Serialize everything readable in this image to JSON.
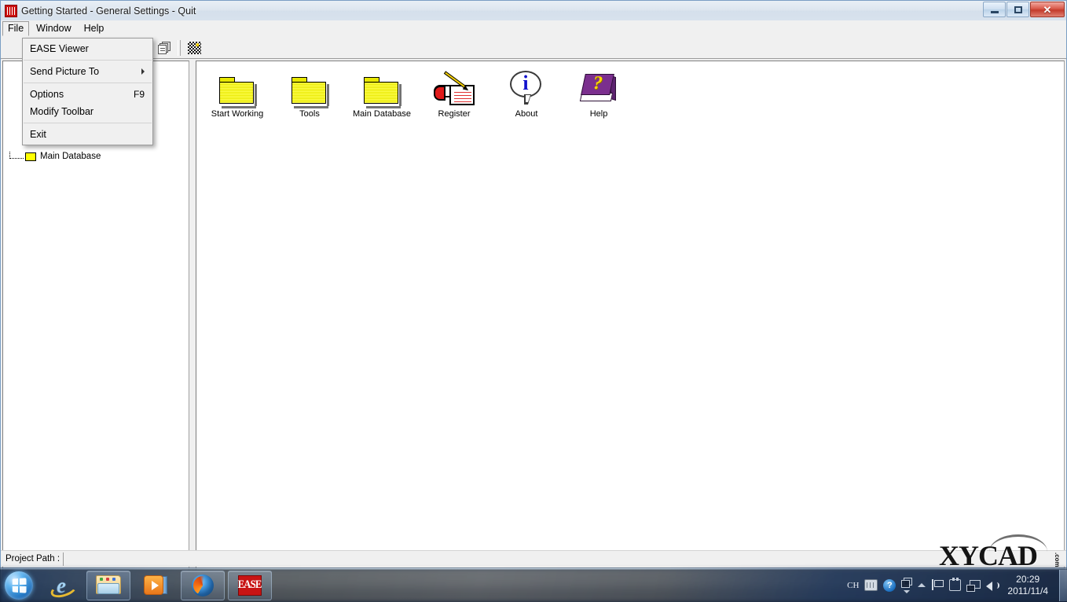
{
  "window": {
    "title": "Getting Started - General Settings - Quit",
    "app_icon": "ease-logo-icon",
    "controls": {
      "minimize": "minimize-icon",
      "maximize": "restore-icon",
      "close": "✕"
    }
  },
  "background_tabs": [
    {
      "label": "",
      "active": false
    },
    {
      "label": "",
      "active": true
    },
    {
      "label": "",
      "active": false
    }
  ],
  "menubar": {
    "items": [
      {
        "label": "File",
        "active": true
      },
      {
        "label": "Window",
        "active": false
      },
      {
        "label": "Help",
        "active": false
      }
    ]
  },
  "file_menu": {
    "open": true,
    "items": [
      {
        "label": "EASE Viewer",
        "accel": "",
        "submenu": false,
        "separator_after": true
      },
      {
        "label": "Send Picture To",
        "accel": "",
        "submenu": true,
        "separator_after": true
      },
      {
        "label": "Options",
        "accel": "F9",
        "submenu": false,
        "separator_after": false
      },
      {
        "label": "Modify Toolbar",
        "accel": "",
        "submenu": false,
        "separator_after": true
      },
      {
        "label": "Exit",
        "accel": "",
        "submenu": false,
        "separator_after": false
      }
    ]
  },
  "toolbar": {
    "buttons": [
      {
        "icon": "copy-windows-icon"
      },
      {
        "icon": "dither-pattern-icon"
      }
    ]
  },
  "tree": {
    "items": [
      {
        "label": "Main Database",
        "icon": "yellow-folder-icon"
      }
    ]
  },
  "shortcuts": [
    {
      "label": "Start Working",
      "icon": "folder-icon"
    },
    {
      "label": "Tools",
      "icon": "folder-icon"
    },
    {
      "label": "Main Database",
      "icon": "folder-icon"
    },
    {
      "label": "Register",
      "icon": "register-pen-icon"
    },
    {
      "label": "About",
      "icon": "info-bubble-icon"
    },
    {
      "label": "Help",
      "icon": "help-book-icon"
    }
  ],
  "statusbar": {
    "label": "Project Path :",
    "value": ""
  },
  "watermark": {
    "text": "XYCAD",
    "suffix": ".com"
  },
  "taskbar": {
    "start": "windows-start-orb",
    "tasks": [
      {
        "name": "internet-explorer",
        "framed": false
      },
      {
        "name": "windows-explorer",
        "framed": true
      },
      {
        "name": "windows-media-player",
        "framed": false
      },
      {
        "name": "mozilla-firefox",
        "framed": true
      },
      {
        "name": "ease",
        "framed": true,
        "label": "EASE"
      }
    ],
    "tray": {
      "input_method": "CH",
      "icons": [
        "keyboard-icon",
        "help-icon",
        "windows-flip-icon",
        "show-hidden-icons-icon",
        "action-center-flag-icon",
        "safely-remove-hardware-icon",
        "network-icon",
        "volume-icon"
      ],
      "time": "20:29",
      "date": "2011/11/4"
    }
  },
  "colors": {
    "accent_red": "#c81414",
    "folder_yellow": "#f2f200",
    "help_purple": "#7b2f8e",
    "info_blue": "#1111cc",
    "window_face": "#f0f0f0"
  }
}
